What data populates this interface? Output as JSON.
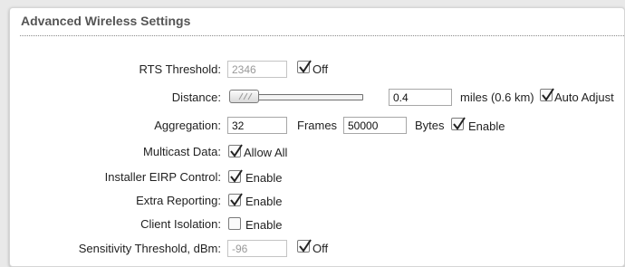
{
  "section_title": "Advanced Wireless Settings",
  "rts": {
    "label": "RTS Threshold:",
    "value": "2346",
    "checkbox_label": "Off",
    "checked": true
  },
  "distance": {
    "label": "Distance:",
    "slider_fraction": 0.0,
    "value": "0.4",
    "unit": "miles (0.6 km)",
    "auto_label": "Auto Adjust",
    "auto_checked": true
  },
  "aggregation": {
    "label": "Aggregation:",
    "frames_value": "32",
    "frames_label": "Frames",
    "bytes_value": "50000",
    "bytes_label": "Bytes",
    "enable_label": "Enable",
    "checked": true
  },
  "multicast": {
    "label": "Multicast Data:",
    "checkbox_label": "Allow All",
    "checked": true
  },
  "installer_eirp": {
    "label": "Installer EIRP Control:",
    "checkbox_label": "Enable",
    "checked": true
  },
  "extra_reporting": {
    "label": "Extra Reporting:",
    "checkbox_label": "Enable",
    "checked": true
  },
  "client_isolation": {
    "label": "Client Isolation:",
    "checkbox_label": "Enable",
    "checked": false
  },
  "sensitivity": {
    "label": "Sensitivity Threshold, dBm:",
    "value": "-96",
    "checkbox_label": "Off",
    "checked": true
  }
}
